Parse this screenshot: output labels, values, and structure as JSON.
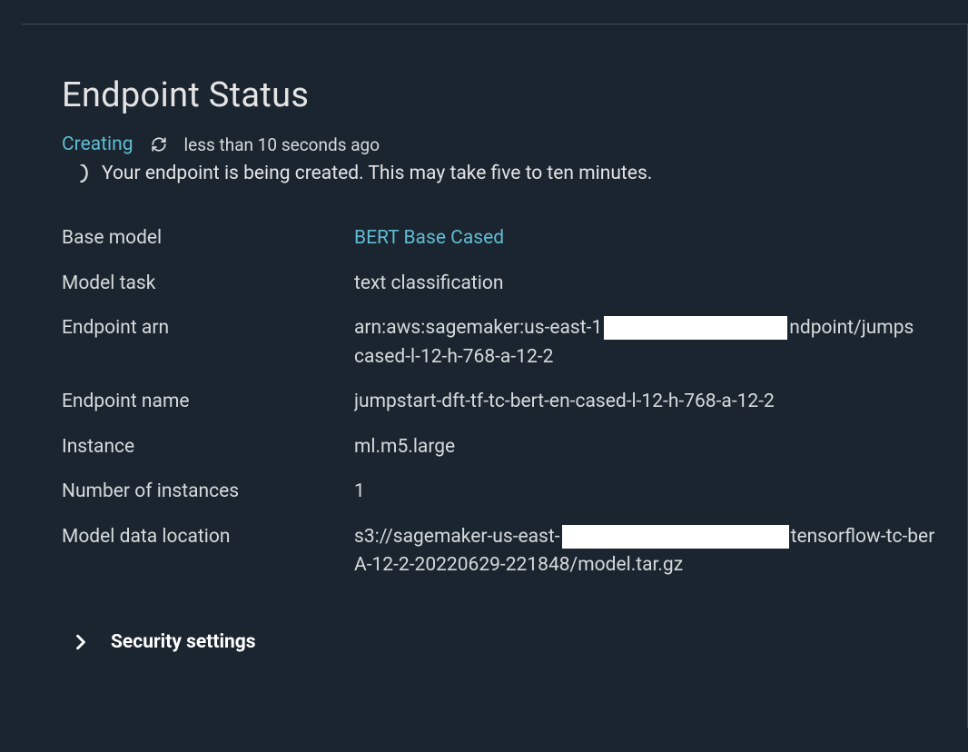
{
  "page": {
    "title": "Endpoint Status"
  },
  "status": {
    "state": "Creating",
    "timestamp": "less than 10 seconds ago",
    "message": "Your endpoint is being created. This may take five to ten minutes."
  },
  "details": {
    "base_model": {
      "label": "Base model",
      "value": "BERT Base Cased"
    },
    "model_task": {
      "label": "Model task",
      "value": "text classification"
    },
    "endpoint_arn": {
      "label": "Endpoint arn",
      "value_prefix": "arn:aws:sagemaker:us-east-1",
      "value_mid": "ndpoint/jumps",
      "value_suffix": "cased-l-12-h-768-a-12-2"
    },
    "endpoint_name": {
      "label": "Endpoint name",
      "value": "jumpstart-dft-tf-tc-bert-en-cased-l-12-h-768-a-12-2"
    },
    "instance": {
      "label": "Instance",
      "value": "ml.m5.large"
    },
    "num_instances": {
      "label": "Number of instances",
      "value": "1"
    },
    "model_data_location": {
      "label": "Model data location",
      "value_prefix": "s3://sagemaker-us-east-",
      "value_mid": "tensorflow-tc-ber",
      "value_suffix": "A-12-2-20220629-221848/model.tar.gz"
    }
  },
  "expander": {
    "security_settings": "Security settings"
  }
}
